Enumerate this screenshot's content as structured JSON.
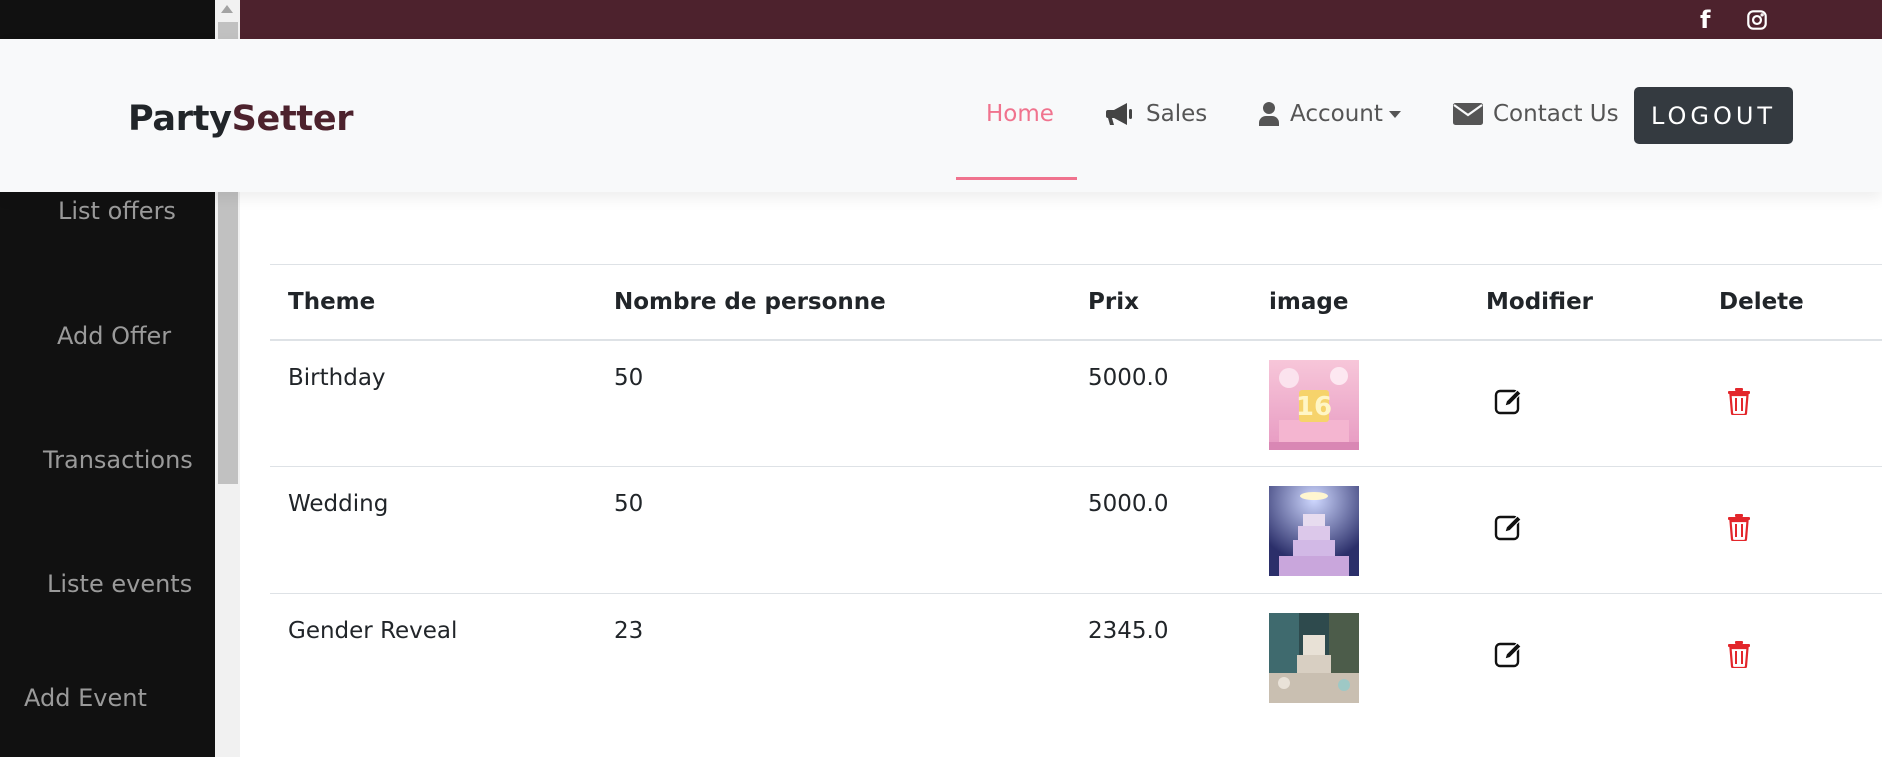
{
  "topbar": {
    "facebook_icon": "facebook-icon",
    "instagram_icon": "instagram-icon",
    "color": "#4d222d"
  },
  "sidebar": {
    "items": [
      {
        "label": "List offers"
      },
      {
        "label": "Add Offer"
      },
      {
        "label": "Transactions"
      },
      {
        "label": "Liste events"
      },
      {
        "label": "Add Event"
      }
    ]
  },
  "navbar": {
    "brand_part1": "Party",
    "brand_part2": "Setter",
    "home": "Home",
    "sales": "Sales",
    "account": "Account",
    "contact": "Contact Us",
    "logout": "LOGOUT",
    "active_color": "#f0738e"
  },
  "table": {
    "headers": [
      "Theme",
      "Nombre de personne",
      "Prix",
      "image",
      "Modifier",
      "Delete"
    ],
    "rows": [
      {
        "theme": "Birthday",
        "persons": "50",
        "price": "5000.0",
        "image": "birthday-cake-photo"
      },
      {
        "theme": "Wedding",
        "persons": "50",
        "price": "5000.0",
        "image": "wedding-cake-photo"
      },
      {
        "theme": "Gender Reveal",
        "persons": "23",
        "price": "2345.0",
        "image": "gender-reveal-photo"
      }
    ],
    "edit_icon": "edit-icon",
    "delete_icon": "trash-icon",
    "delete_color": "#e3262b"
  }
}
